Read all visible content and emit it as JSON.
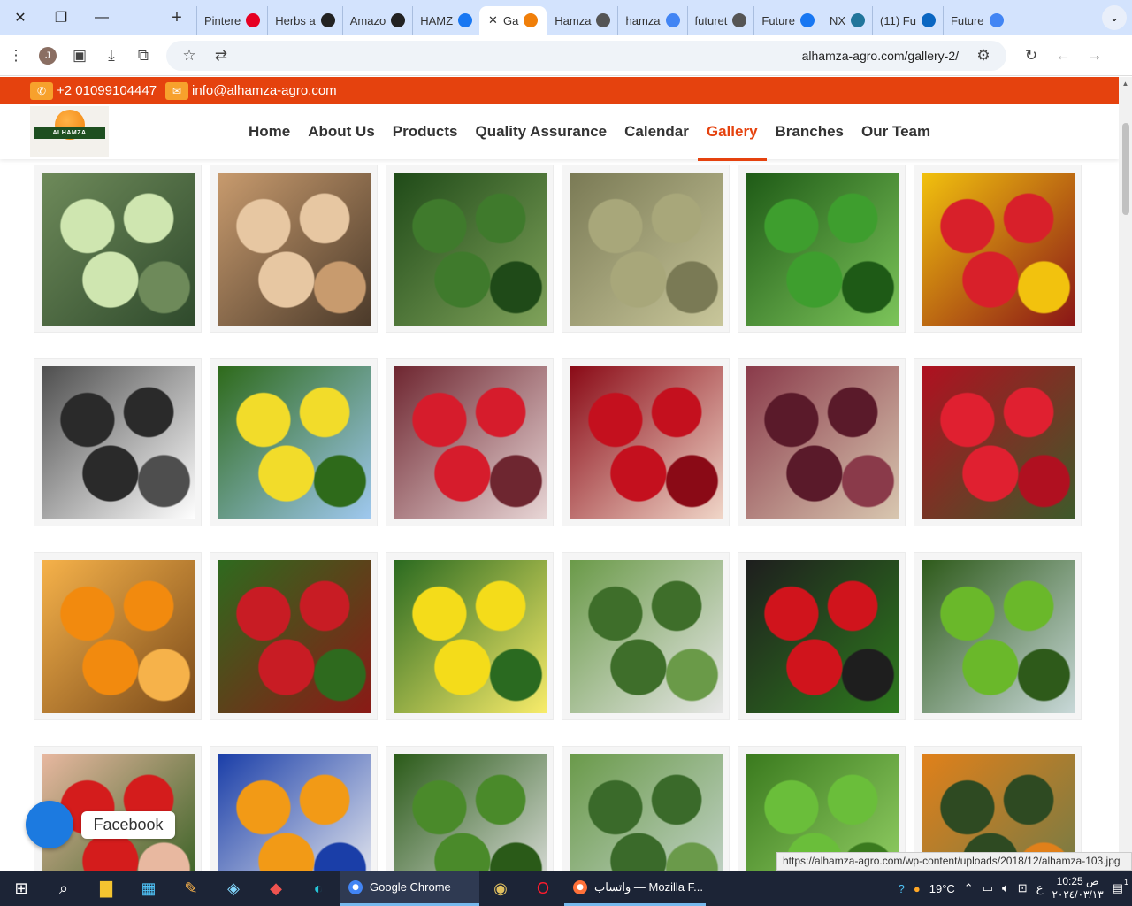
{
  "browser": {
    "tabs": [
      {
        "label": "Pintere",
        "icon": "pinterest-icon",
        "color": "#e60023"
      },
      {
        "label": "Herbs a",
        "icon": "tn-icon",
        "color": "#222222"
      },
      {
        "label": "Amazo",
        "icon": "amazon-icon",
        "color": "#222222"
      },
      {
        "label": "HAMZ",
        "icon": "facebook-icon",
        "color": "#1877f2"
      },
      {
        "label": "Ga",
        "icon": "site-icon",
        "color": "#f07f0a",
        "active": true
      },
      {
        "label": "Hamza",
        "icon": "globe-icon",
        "color": "#555555"
      },
      {
        "label": "hamza",
        "icon": "google-icon",
        "color": "#4285f4"
      },
      {
        "label": "futuret",
        "icon": "globe-icon",
        "color": "#555555"
      },
      {
        "label": "Future",
        "icon": "facebook-icon",
        "color": "#1877f2"
      },
      {
        "label": "NX",
        "icon": "wordpress-icon",
        "color": "#21759b"
      },
      {
        "label": "(11) Fu",
        "icon": "linkedin-icon",
        "color": "#0a66c2"
      },
      {
        "label": "Future",
        "icon": "google-icon",
        "color": "#4285f4"
      }
    ],
    "profile_initial": "J",
    "url": "alhamza-agro.com/gallery-2/"
  },
  "site": {
    "phone": "+2 01099104447",
    "email": "info@alhamza-agro.com",
    "logo_text": "ALHAMZA",
    "nav": [
      "Home",
      "About Us",
      "Products",
      "Quality Assurance",
      "Calendar",
      "Gallery",
      "Branches",
      "Our Team"
    ],
    "active_nav": "Gallery",
    "accent": "#e5420e"
  },
  "gallery": {
    "items": [
      {
        "name": "cabbage",
        "colors": [
          "#cfe6b0",
          "#6e8a5a",
          "#2f4a2c"
        ]
      },
      {
        "name": "chickpeas",
        "colors": [
          "#e7c7a2",
          "#c89b6e",
          "#4b3a2a"
        ]
      },
      {
        "name": "zucchini",
        "colors": [
          "#3f7a2c",
          "#1f4a18",
          "#7fa25a"
        ]
      },
      {
        "name": "fennel seeds",
        "colors": [
          "#a8a77a",
          "#7a7a55",
          "#c8c69a"
        ]
      },
      {
        "name": "green chili peppers",
        "colors": [
          "#3e9e2e",
          "#1e5a16",
          "#7cc45a"
        ]
      },
      {
        "name": "bell peppers",
        "colors": [
          "#d8202a",
          "#f2c20e",
          "#8a1616"
        ]
      },
      {
        "name": "dried black lime",
        "colors": [
          "#2a2a2a",
          "#4e4e4e",
          "#ffffff"
        ]
      },
      {
        "name": "lemon tree",
        "colors": [
          "#f2dc2a",
          "#2e6a1a",
          "#9fc8ef"
        ]
      },
      {
        "name": "strawberry boxes",
        "colors": [
          "#d61c2c",
          "#6e2630",
          "#e8d6d6"
        ]
      },
      {
        "name": "pomegranate",
        "colors": [
          "#c4101e",
          "#8a0a16",
          "#f0d6c8"
        ]
      },
      {
        "name": "hibiscus",
        "colors": [
          "#5a1a2a",
          "#8a3a4a",
          "#d8c7b0"
        ]
      },
      {
        "name": "red chili",
        "colors": [
          "#e02030",
          "#b01020",
          "#3e5a2a"
        ]
      },
      {
        "name": "oranges",
        "colors": [
          "#f28a0e",
          "#f6b24a",
          "#7a4a1a"
        ]
      },
      {
        "name": "strawberries",
        "colors": [
          "#c81c24",
          "#2e6a1e",
          "#8a1a16"
        ]
      },
      {
        "name": "lemons",
        "colors": [
          "#f4dc1a",
          "#2a6a20",
          "#f8ec6a"
        ]
      },
      {
        "name": "broccoli",
        "colors": [
          "#3e6e2a",
          "#6a9a48",
          "#e6e6e6"
        ]
      },
      {
        "name": "red peppers crate",
        "colors": [
          "#d0141c",
          "#1e1e1e",
          "#2e7a1e"
        ]
      },
      {
        "name": "limes",
        "colors": [
          "#6ab82a",
          "#2e5a1a",
          "#c8d8d8"
        ]
      },
      {
        "name": "strawberry hand",
        "colors": [
          "#d41c1c",
          "#e8b8a0",
          "#2a5a1a"
        ]
      },
      {
        "name": "oranges stickered",
        "colors": [
          "#f29a16",
          "#1a3ea8",
          "#f4f4f4"
        ]
      },
      {
        "name": "parsley",
        "colors": [
          "#4a8a2a",
          "#2a5a18",
          "#e6e6e6"
        ]
      },
      {
        "name": "broccoli heads",
        "colors": [
          "#3a6a2a",
          "#6a9a4a",
          "#c8d6d0"
        ]
      },
      {
        "name": "mint leaves",
        "colors": [
          "#6abe3a",
          "#3a7a1e",
          "#9ad66a"
        ]
      },
      {
        "name": "orange orchard",
        "colors": [
          "#2e4a22",
          "#e0801a",
          "#6a7a4a"
        ]
      }
    ]
  },
  "floating": {
    "facebook_label": "Facebook"
  },
  "status_url": "https://alhamza-agro.com/wp-content/uploads/2018/12/alhamza-103.jpg",
  "taskbar": {
    "chrome_label": "Google Chrome",
    "firefox_label": "واتساب — Mozilla F...",
    "weather": "19°C",
    "time": "10:25 ص",
    "date": "٢٠٢٤/٠٣/١٣",
    "lang": "ع",
    "notifications": "1"
  }
}
